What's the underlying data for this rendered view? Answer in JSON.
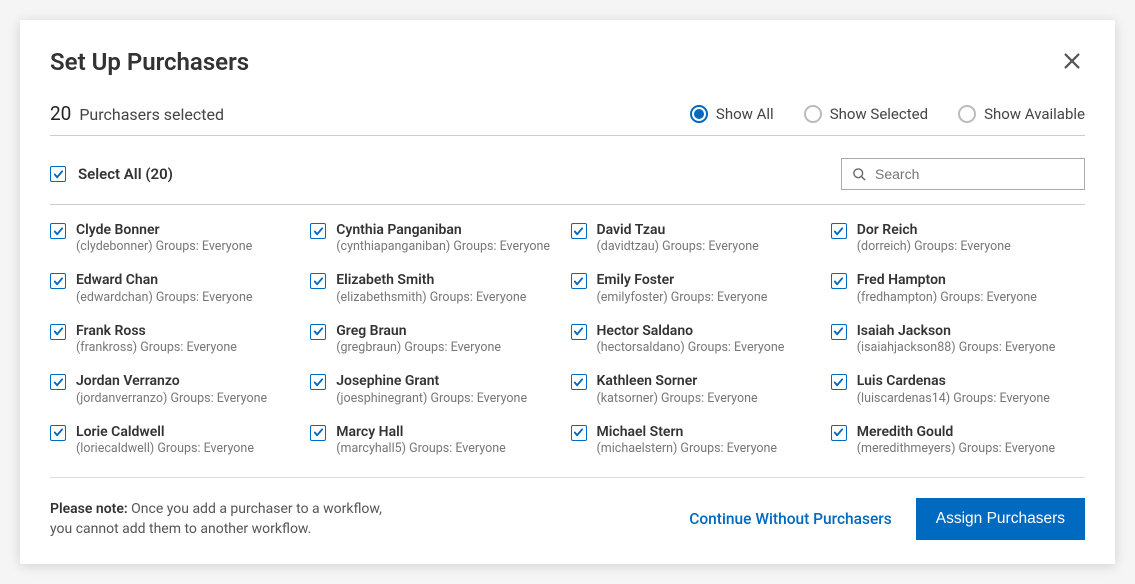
{
  "title": "Set Up Purchasers",
  "selected_count": "20",
  "selected_label": "Purchasers selected",
  "filters": {
    "show_all": "Show All",
    "show_selected": "Show Selected",
    "show_available": "Show Available",
    "active": "show_all"
  },
  "select_all_label": "Select All (20)",
  "search_placeholder": "Search",
  "purchasers": [
    {
      "name": "Clyde Bonner",
      "sub": "(clydebonner) Groups: Everyone"
    },
    {
      "name": "Cynthia Panganiban",
      "sub": "(cynthiapanganiban) Groups: Everyone"
    },
    {
      "name": "David Tzau",
      "sub": "(davidtzau) Groups: Everyone"
    },
    {
      "name": "Dor Reich",
      "sub": "(dorreich) Groups: Everyone"
    },
    {
      "name": "Edward Chan",
      "sub": "(edwardchan) Groups: Everyone"
    },
    {
      "name": "Elizabeth Smith",
      "sub": "(elizabethsmith) Groups: Everyone"
    },
    {
      "name": "Emily Foster",
      "sub": "(emilyfoster) Groups: Everyone"
    },
    {
      "name": "Fred Hampton",
      "sub": "(fredhampton) Groups: Everyone"
    },
    {
      "name": "Frank Ross",
      "sub": "(frankross) Groups: Everyone"
    },
    {
      "name": "Greg Braun",
      "sub": "(gregbraun) Groups: Everyone"
    },
    {
      "name": "Hector Saldano",
      "sub": "(hectorsaldano) Groups: Everyone"
    },
    {
      "name": "Isaiah Jackson",
      "sub": "(isaiahjackson88) Groups: Everyone"
    },
    {
      "name": "Jordan Verranzo",
      "sub": "(jordanverranzo) Groups: Everyone"
    },
    {
      "name": "Josephine Grant",
      "sub": "(joesphinegrant) Groups: Everyone"
    },
    {
      "name": "Kathleen Sorner",
      "sub": "(katsorner) Groups: Everyone"
    },
    {
      "name": "Luis Cardenas",
      "sub": "(luiscardenas14) Groups: Everyone"
    },
    {
      "name": "Lorie Caldwell",
      "sub": "(loriecaldwell) Groups: Everyone"
    },
    {
      "name": "Marcy Hall",
      "sub": "(marcyhall5) Groups: Everyone"
    },
    {
      "name": "Michael Stern",
      "sub": "(michaelstern) Groups: Everyone"
    },
    {
      "name": "Meredith Gould",
      "sub": "(meredithmeyers) Groups: Everyone"
    }
  ],
  "note_bold": "Please note:",
  "note_line1": " Once you add a purchaser to a workflow,",
  "note_line2": "you cannot add them to another workflow.",
  "continue_btn": "Continue Without Purchasers",
  "assign_btn": "Assign Purchasers"
}
